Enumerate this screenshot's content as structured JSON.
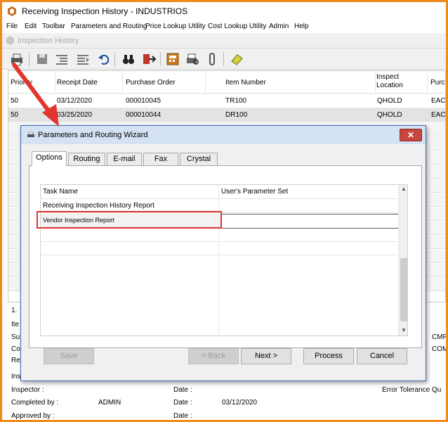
{
  "app": {
    "title": "Receiving Inspection History - INDUSTRIOS",
    "menu": [
      "File",
      "Edit",
      "Toolbar",
      "Parameters and Routing",
      "Price Lookup Utility",
      "Cost Lookup Utility",
      "Admin",
      "Help"
    ]
  },
  "child_window": {
    "title": "Inspection History"
  },
  "toolbar": {
    "icons": [
      "print-icon",
      "save-icon",
      "indent-icon",
      "outdent-icon",
      "undo-icon",
      "binoculars-icon",
      "exit-icon",
      "calculator-icon",
      "print-preview-icon",
      "attachment-icon",
      "eraser-icon"
    ]
  },
  "grid": {
    "headers": {
      "priority": "Priority",
      "receipt_date": "Receipt Date",
      "purchase_order": "Purchase Order",
      "item_number": "Item Number",
      "inspect_location": [
        "Inspect",
        "Location"
      ],
      "purchase_uom": "Purch"
    },
    "rows": [
      {
        "priority": "50",
        "receipt_date": "03/12/2020",
        "purchase_order": "000010045",
        "item_number": "TR100",
        "inspect_location": "QHOLD",
        "uom": "EACH"
      },
      {
        "priority": "50",
        "receipt_date": "03/25/2020",
        "purchase_order": "000010044",
        "item_number": "DR100",
        "inspect_location": "QHOLD",
        "uom": "EACH"
      }
    ]
  },
  "form": {
    "row_number": "1.",
    "left_fragments": [
      "Ite",
      "Su",
      "Co",
      "Re",
      "Ins"
    ],
    "right_fragments": [
      "CMP",
      "COM"
    ],
    "inspector_label": "Inspector :",
    "completed_by_label": "Completed by :",
    "completed_by_value": "ADMIN",
    "approved_by_label": "Approved by :",
    "date_label": "Date :",
    "completed_date_value": "03/12/2020",
    "error_tolerance_label": "Error Tolerance Qu"
  },
  "dialog": {
    "title": "Parameters and Routing Wizard",
    "close_label": "✕",
    "tabs": [
      "Options",
      "Routing",
      "E-mail",
      "Fax",
      "Crystal"
    ],
    "active_tab": "Options",
    "columns": {
      "task_name": "Task Name",
      "parameter_set": "User's Parameter Set"
    },
    "tasks": [
      {
        "task_name": "Receiving Inspection History Report",
        "parameter_set": ""
      },
      {
        "task_name": "Vendor Inspection Report",
        "parameter_set": ""
      }
    ],
    "buttons": {
      "save": "Save",
      "back": "< Back",
      "next": "Next >",
      "process": "Process",
      "cancel": "Cancel"
    }
  },
  "colors": {
    "window_border": "#f08a1c",
    "annotation": "#e3342f",
    "dialog_title_bg": "#d4e2f3",
    "close_button": "#c7463e"
  }
}
